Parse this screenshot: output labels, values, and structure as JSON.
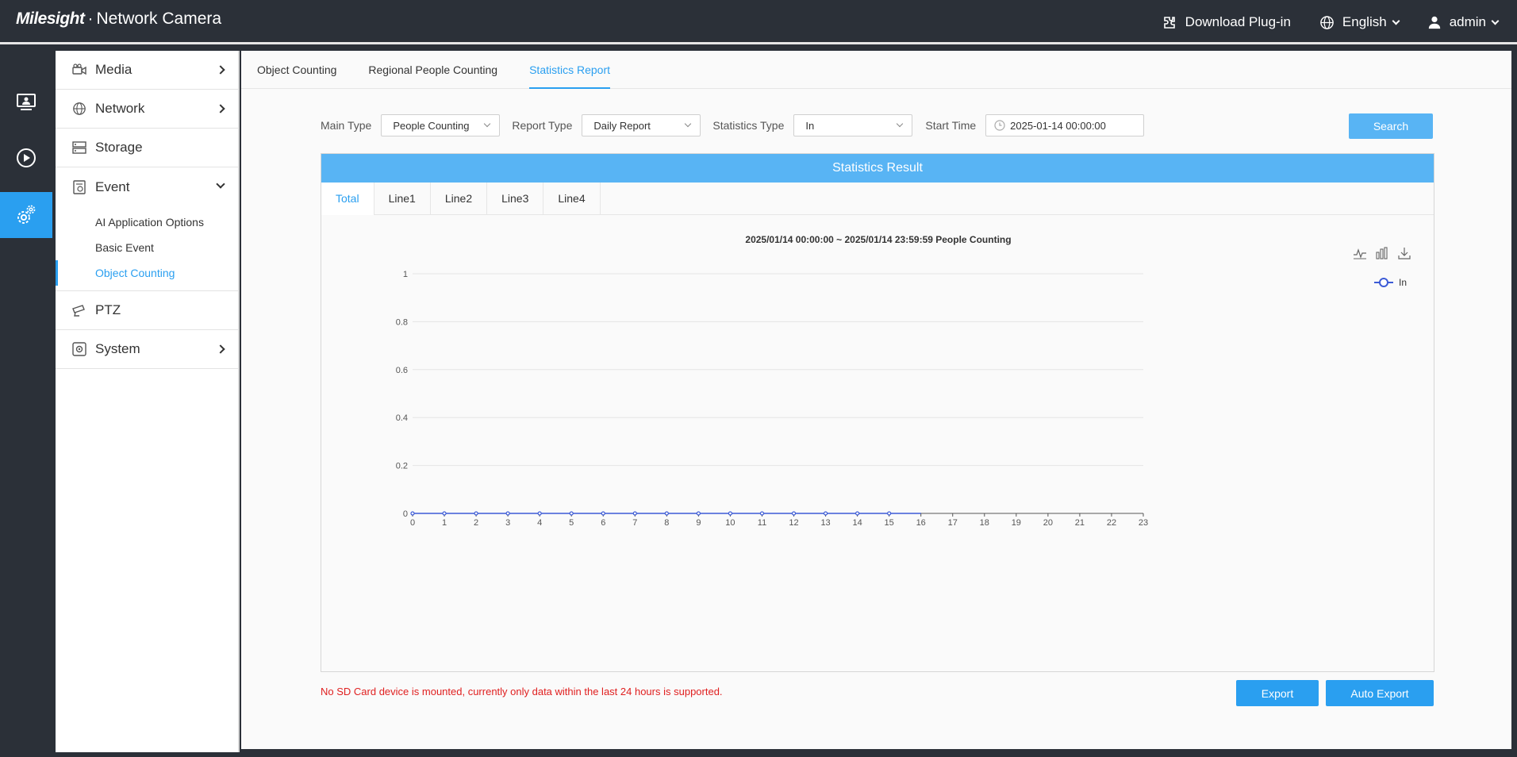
{
  "header": {
    "brand_logo": "Milesight",
    "brand_product": "Network Camera",
    "download_plugin": "Download Plug-in",
    "language": "English",
    "user": "admin"
  },
  "rail": [
    {
      "icon": "live-view-icon"
    },
    {
      "icon": "playback-icon"
    },
    {
      "icon": "settings-icon",
      "active": true
    }
  ],
  "menu": {
    "media": "Media",
    "network": "Network",
    "storage": "Storage",
    "event": "Event",
    "event_sub": {
      "ai_options": "AI Application Options",
      "basic_event": "Basic Event",
      "object_counting": "Object Counting"
    },
    "ptz": "PTZ",
    "system": "System"
  },
  "tabs": [
    "Object Counting",
    "Regional People Counting",
    "Statistics Report"
  ],
  "filters": {
    "main_type_label": "Main Type",
    "main_type_value": "People Counting",
    "report_type_label": "Report Type",
    "report_type_value": "Daily Report",
    "stats_type_label": "Statistics Type",
    "stats_type_value": "In",
    "start_time_label": "Start Time",
    "start_time_value": "2025-01-14 00:00:00",
    "search": "Search"
  },
  "result": {
    "title": "Statistics Result",
    "tabs": [
      "Total",
      "Line1",
      "Line2",
      "Line3",
      "Line4"
    ],
    "chart_title": "2025/01/14 00:00:00  ~  2025/01/14 23:59:59 People Counting"
  },
  "chart_data": {
    "type": "line",
    "title": "2025/01/14 00:00:00  ~  2025/01/14 23:59:59 People Counting",
    "xlabel": "",
    "ylabel": "",
    "x": [
      0,
      1,
      2,
      3,
      4,
      5,
      6,
      7,
      8,
      9,
      10,
      11,
      12,
      13,
      14,
      15,
      16,
      17,
      18,
      19,
      20,
      21,
      22,
      23
    ],
    "series": [
      {
        "name": "In",
        "x": [
          0,
          1,
          2,
          3,
          4,
          5,
          6,
          7,
          8,
          9,
          10,
          11,
          12,
          13,
          14,
          15,
          16
        ],
        "values": [
          0,
          0,
          0,
          0,
          0,
          0,
          0,
          0,
          0,
          0,
          0,
          0,
          0,
          0,
          0,
          0,
          0
        ]
      }
    ],
    "yticks": [
      0,
      0.2,
      0.4,
      0.6,
      0.8,
      1
    ],
    "ylim": [
      0,
      1
    ],
    "xlim": [
      0,
      23
    ],
    "grid": true,
    "legend": "top-right",
    "color": "#3c5bd6"
  },
  "footer": {
    "notice": "No SD Card device is mounted, currently only data within the last 24 hours is supported.",
    "export": "Export",
    "auto_export": "Auto Export"
  },
  "colors": {
    "accent": "#2a9ff0",
    "header_bg": "#2b3038",
    "notice": "#e02020"
  }
}
